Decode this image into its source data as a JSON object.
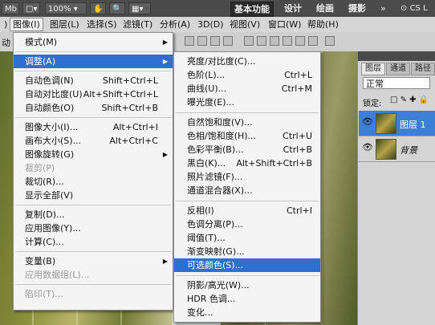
{
  "appbar": {
    "chip_mb": "Mb",
    "zoom": "100%",
    "workspaces": [
      "基本功能",
      "设计",
      "绘画",
      "摄影"
    ],
    "cs_live": "CS L"
  },
  "menubar": [
    "图像(I)",
    "图层(L)",
    "选择(S)",
    "滤镜(T)",
    "分析(A)",
    "3D(D)",
    "视图(V)",
    "窗口(W)",
    "帮助(H)"
  ],
  "options_left": "动",
  "panel": {
    "tabs": [
      "图层",
      "通道",
      "路径"
    ],
    "blend_mode": "正常",
    "lock_label": "锁定:",
    "layers": [
      {
        "name": "图层 1",
        "selected": true
      },
      {
        "name": "背景",
        "selected": false
      }
    ]
  },
  "image_menu": [
    {
      "label": "模式(M)",
      "submenu": true
    },
    {
      "sep": true
    },
    {
      "label": "调整(A)",
      "submenu": true,
      "hl": true
    },
    {
      "sep": true
    },
    {
      "label": "自动色调(N)",
      "sc": "Shift+Ctrl+L"
    },
    {
      "label": "自动对比度(U)",
      "sc": "Alt+Shift+Ctrl+L"
    },
    {
      "label": "自动颜色(O)",
      "sc": "Shift+Ctrl+B"
    },
    {
      "sep": true
    },
    {
      "label": "图像大小(I)...",
      "sc": "Alt+Ctrl+I"
    },
    {
      "label": "画布大小(S)...",
      "sc": "Alt+Ctrl+C"
    },
    {
      "label": "图像旋转(G)",
      "submenu": true
    },
    {
      "label": "裁剪(P)",
      "dis": true
    },
    {
      "label": "裁切(R)..."
    },
    {
      "label": "显示全部(V)"
    },
    {
      "sep": true
    },
    {
      "label": "复制(D)..."
    },
    {
      "label": "应用图像(Y)..."
    },
    {
      "label": "计算(C)..."
    },
    {
      "sep": true
    },
    {
      "label": "变量(B)",
      "submenu": true
    },
    {
      "label": "应用数据组(L)...",
      "dis": true
    },
    {
      "sep": true
    },
    {
      "label": "陷印(T)...",
      "dis": true
    }
  ],
  "adjust_menu": [
    {
      "label": "亮度/对比度(C)..."
    },
    {
      "label": "色阶(L)...",
      "sc": "Ctrl+L"
    },
    {
      "label": "曲线(U)...",
      "sc": "Ctrl+M"
    },
    {
      "label": "曝光度(E)..."
    },
    {
      "sep": true
    },
    {
      "label": "自然饱和度(V)..."
    },
    {
      "label": "色相/饱和度(H)...",
      "sc": "Ctrl+U"
    },
    {
      "label": "色彩平衡(B)...",
      "sc": "Ctrl+B"
    },
    {
      "label": "黑白(K)...",
      "sc": "Alt+Shift+Ctrl+B"
    },
    {
      "label": "照片滤镜(F)..."
    },
    {
      "label": "通道混合器(X)..."
    },
    {
      "sep": true
    },
    {
      "label": "反相(I)",
      "sc": "Ctrl+I"
    },
    {
      "label": "色调分离(P)..."
    },
    {
      "label": "阈值(T)..."
    },
    {
      "label": "渐变映射(G)..."
    },
    {
      "label": "可选颜色(S)...",
      "hl": true
    },
    {
      "sep": true
    },
    {
      "label": "阴影/高光(W)..."
    },
    {
      "label": "HDR 色调..."
    },
    {
      "label": "变化..."
    }
  ],
  "colors": {
    "highlight": "#2f6fd2",
    "layer_selected": "#3d7fd6"
  }
}
